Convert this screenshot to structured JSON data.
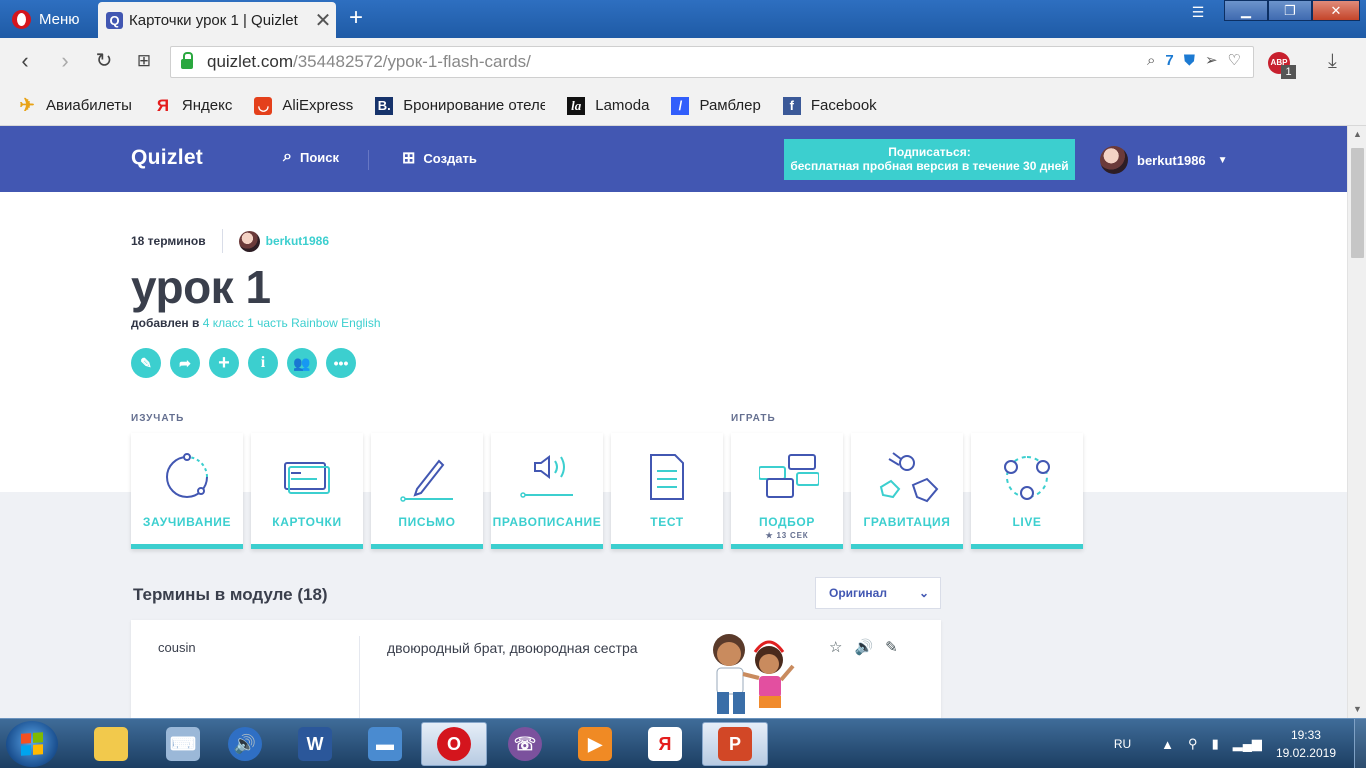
{
  "browser": {
    "menu_label": "Меню",
    "tab_title": "Карточки урок 1 | Quizlet",
    "tab_close": "✕",
    "new_tab": "+",
    "url_host": "quizlet.com",
    "url_path": "/354482572/урок-1-flash-cards/",
    "tracker_count": "7",
    "adblock_label": "ABP",
    "adblock_count": "1",
    "bookmarks": [
      {
        "label": "Авиабилеты",
        "icon": "plane-icon"
      },
      {
        "label": "Яндекс",
        "icon": "yandex-icon"
      },
      {
        "label": "AliExpress",
        "icon": "aliexpress-icon"
      },
      {
        "label": "Бронирование отеле",
        "icon": "booking-icon"
      },
      {
        "label": "Lamoda",
        "icon": "lamoda-icon"
      },
      {
        "label": "Рамблер",
        "icon": "rambler-icon"
      },
      {
        "label": "Facebook",
        "icon": "facebook-icon"
      }
    ]
  },
  "header": {
    "logo": "Quizlet",
    "search_label": "Поиск",
    "create_label": "Создать",
    "upgrade_line1": "Подписаться:",
    "upgrade_line2": "бесплатная пробная версия в течение 30 дней",
    "username": "berkut1986"
  },
  "set": {
    "term_count": "18 терминов",
    "creator": "berkut1986",
    "title": "урок 1",
    "added_prefix": "добавлен в",
    "folder": "4 класс 1 часть Rainbow English"
  },
  "sections": {
    "study": "ИЗУЧАТЬ",
    "play": "ИГРАТЬ"
  },
  "modes": [
    {
      "label": "ЗАУЧИВАНИЕ",
      "icon": "learn-icon"
    },
    {
      "label": "КАРТОЧКИ",
      "icon": "flashcards-icon"
    },
    {
      "label": "ПИСЬМО",
      "icon": "write-icon"
    },
    {
      "label": "ПРАВОПИСАНИЕ",
      "icon": "spell-icon"
    },
    {
      "label": "ТЕСТ",
      "icon": "test-icon"
    },
    {
      "label": "ПОДБОР",
      "sub": "★ 13 СЕК",
      "icon": "match-icon"
    },
    {
      "label": "ГРАВИТАЦИЯ",
      "icon": "gravity-icon"
    },
    {
      "label": "LIVE",
      "icon": "live-icon"
    }
  ],
  "terms": {
    "heading": "Термины в модуле (18)",
    "sort_value": "Оригинал",
    "rows": [
      {
        "term": "cousin",
        "definition": "двоюродный брат, двоюродная сестра"
      }
    ]
  },
  "taskbar": {
    "lang": "RU",
    "time": "19:33",
    "date": "19.02.2019",
    "apps": [
      "explorer",
      "remote-desktop",
      "media-player",
      "word",
      "scanner",
      "opera",
      "viber",
      "video-player",
      "yandex-browser",
      "powerpoint"
    ]
  },
  "colors": {
    "brand": "#4257b2",
    "accent": "#3ccfcf",
    "grey_bg": "#eff1f5"
  }
}
